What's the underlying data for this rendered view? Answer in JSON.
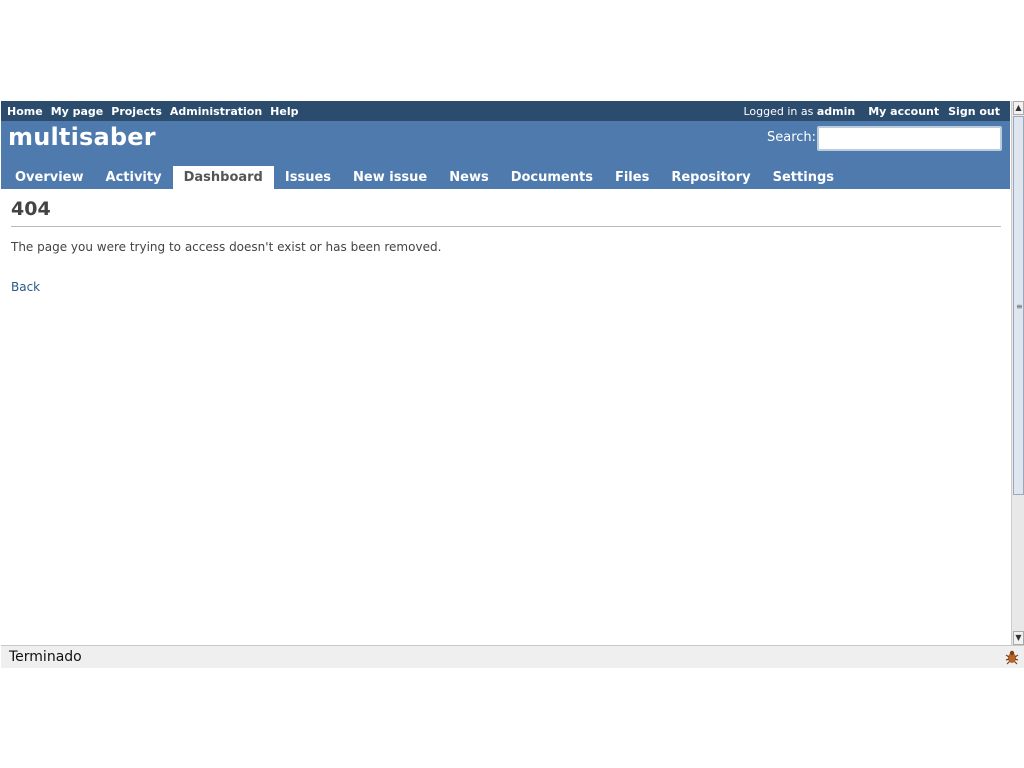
{
  "top_menu": {
    "left_items": [
      "Home",
      "My page",
      "Projects",
      "Administration",
      "Help"
    ],
    "logged_prefix": "Logged in as",
    "user": "admin",
    "my_account": "My account",
    "sign_out": "Sign out"
  },
  "header": {
    "project_title": "multisaber",
    "search_label": "Search:",
    "search_value": ""
  },
  "main_menu": {
    "tabs": [
      {
        "label": "Overview",
        "selected": false
      },
      {
        "label": "Activity",
        "selected": false
      },
      {
        "label": "Dashboard",
        "selected": true
      },
      {
        "label": "Issues",
        "selected": false
      },
      {
        "label": "New issue",
        "selected": false
      },
      {
        "label": "News",
        "selected": false
      },
      {
        "label": "Documents",
        "selected": false
      },
      {
        "label": "Files",
        "selected": false
      },
      {
        "label": "Repository",
        "selected": false
      },
      {
        "label": "Settings",
        "selected": false
      }
    ]
  },
  "content": {
    "heading": "404",
    "message": "The page you were trying to access doesn't exist or has been removed.",
    "back_label": "Back"
  },
  "statusbar": {
    "text": "Terminado",
    "icon": "bug-icon"
  },
  "colors": {
    "top_menu_bg": "#2c4c6e",
    "header_bg": "#4e7aad",
    "link": "#2a5a8a"
  }
}
